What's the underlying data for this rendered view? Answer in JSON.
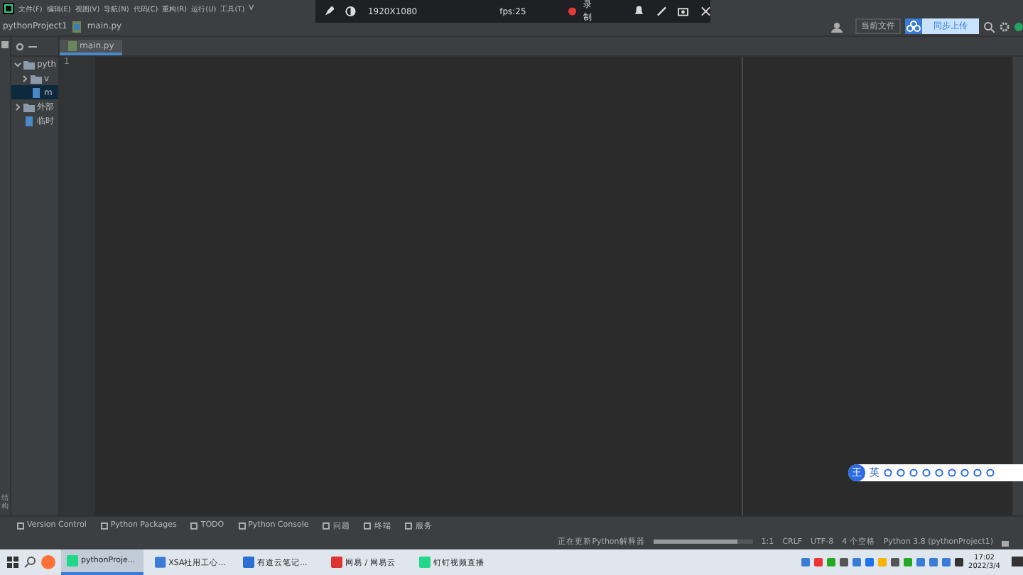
{
  "menu": [
    "文件(F)",
    "编辑(E)",
    "视图(V)",
    "导航(N)",
    "代码(C)",
    "重构(R)",
    "运行(U)",
    "工具(T)",
    "V"
  ],
  "breadcrumb": [
    "pythonProject1",
    "main.py"
  ],
  "toolbar": {
    "run_config": "当前文件",
    "upload_button": "同步上传"
  },
  "project_tree": [
    {
      "label": "pyth",
      "expanded": true,
      "selected": false,
      "children": [
        {
          "label": "v",
          "expanded": false,
          "selected": false
        },
        {
          "label": "m",
          "selected": true
        }
      ]
    },
    {
      "label": "外部",
      "expanded": false,
      "selected": false
    },
    {
      "label": "临时",
      "selected": false
    }
  ],
  "editor_tabs": [
    {
      "label": "main.py",
      "selected": true
    }
  ],
  "line_numbers": [
    "1"
  ],
  "side_tab": "结构",
  "tool_windows": [
    "Version Control",
    "Python Packages",
    "TODO",
    "Python Console",
    "问题",
    "终端",
    "服务"
  ],
  "status_bar": {
    "task": "正在更新Python解释器",
    "progress": {
      "level": 0.85
    },
    "items": [
      "1:1",
      "CRLF",
      "UTF-8",
      "4 个空格",
      "Python 3.8 (pythonProject1)"
    ]
  },
  "recorder": {
    "resolution": "1920X1080",
    "fps": "fps:25",
    "record_label": "录制"
  },
  "ime": {
    "logo": "王",
    "mode": "英"
  },
  "taskbar": {
    "apps": [
      {
        "label": "pythonProje...",
        "selected": true
      },
      {
        "label": "XSA社用工心...",
        "selected": false
      },
      {
        "label": "有道云笔记...",
        "selected": false
      },
      {
        "label": "网易 / 网易云",
        "selected": false
      },
      {
        "label": "钉钉视频直播",
        "selected": false
      }
    ],
    "time": "17:02",
    "date": "2022/3/4"
  }
}
